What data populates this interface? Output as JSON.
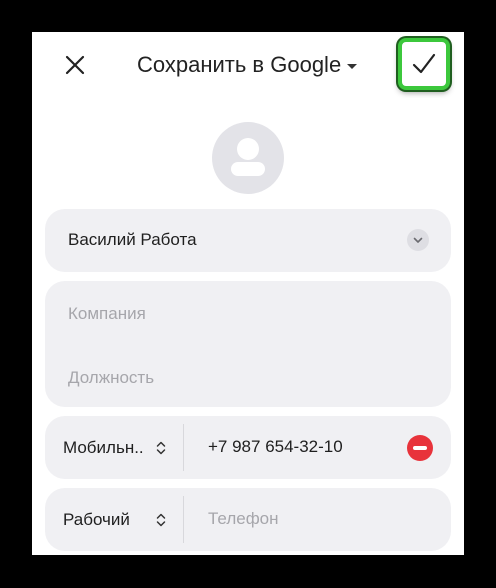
{
  "header": {
    "title": "Сохранить в Google"
  },
  "contact": {
    "name": "Василий Работа",
    "company_placeholder": "Компания",
    "position_placeholder": "Должность"
  },
  "phones": [
    {
      "type": "Мобильн..",
      "value": "+7 987 654-32-10"
    },
    {
      "type": "Рабочий",
      "placeholder": "Телефон"
    }
  ],
  "colors": {
    "save_highlight": "#3cc83c",
    "remove": "#e8333b",
    "card_bg": "#f0f0f3"
  },
  "icons": {
    "close": "close-icon",
    "save": "checkmark-icon",
    "account": "account-icon",
    "expand": "chevron-down-icon",
    "type_select": "unfold-icon",
    "remove": "remove-circle-icon"
  }
}
